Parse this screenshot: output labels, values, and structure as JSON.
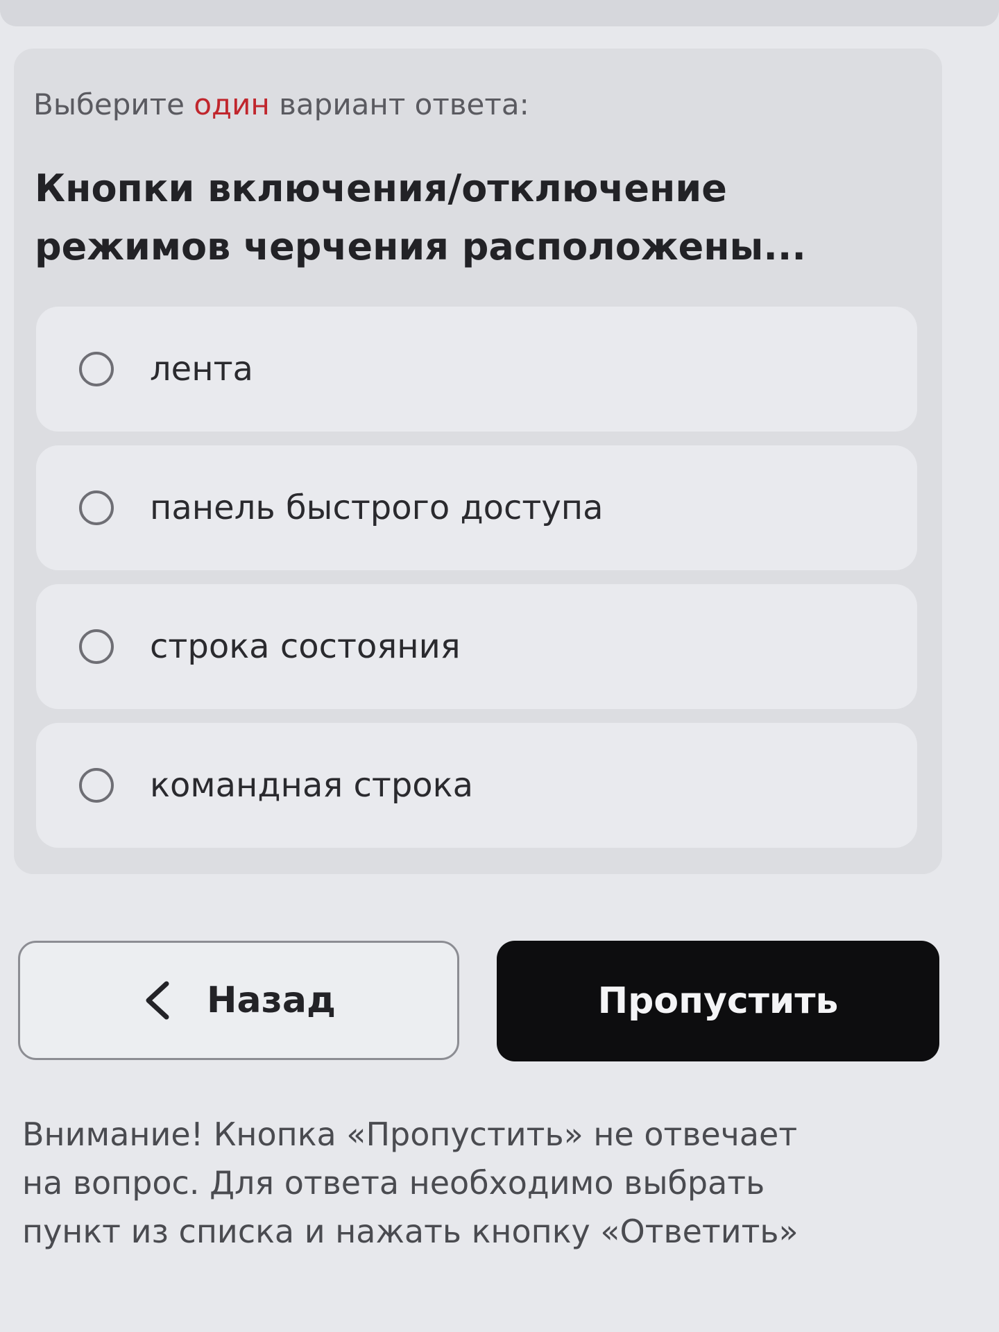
{
  "instruction": {
    "prefix": "Выберите ",
    "accent": "один",
    "suffix": " вариант ответа:",
    "accent_color": "#c0262d"
  },
  "question": {
    "line1": "Кнопки включения/отключение",
    "line2": "режимов черчения расположены..."
  },
  "options": [
    {
      "label": "лента",
      "selected": false
    },
    {
      "label": "панель быстрого доступа",
      "selected": false
    },
    {
      "label": "строка состояния",
      "selected": false
    },
    {
      "label": "командная строка",
      "selected": false
    }
  ],
  "buttons": {
    "back_label": "Назад",
    "back_icon": "chevron-left-icon",
    "skip_label": "Пропустить"
  },
  "notice": {
    "line1": "Внимание! Кнопка «Пропустить» не отвечает",
    "line2": "на вопрос. Для ответа необходимо выбрать",
    "line3": "пункт из списка и нажать кнопку «Ответить»"
  }
}
